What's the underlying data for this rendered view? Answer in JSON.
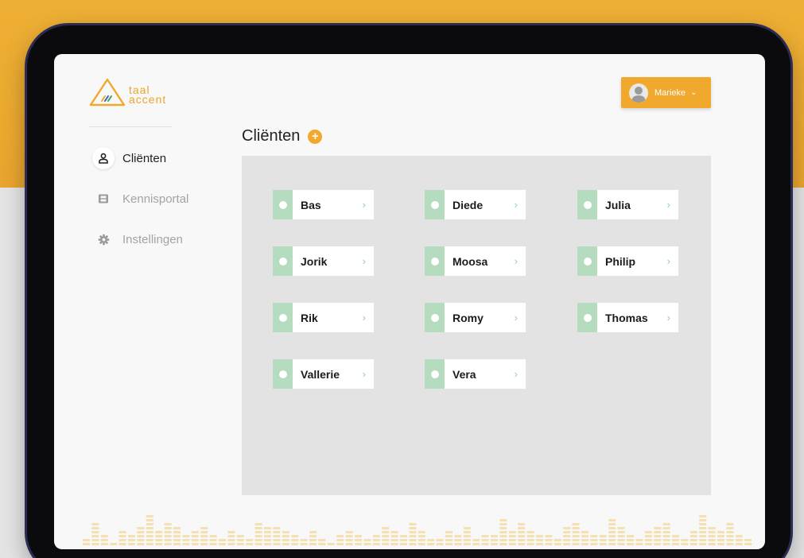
{
  "brand": {
    "line1": "taal",
    "line2": "accent",
    "accent_color": "#f0a92c"
  },
  "user": {
    "name": "Marieke"
  },
  "sidebar": {
    "items": [
      {
        "label": "Cliënten",
        "icon": "user-icon",
        "active": true
      },
      {
        "label": "Kennisportal",
        "icon": "film-icon",
        "active": false
      },
      {
        "label": "Instellingen",
        "icon": "gear-icon",
        "active": false
      }
    ]
  },
  "page": {
    "title": "Cliënten"
  },
  "clients": [
    "Bas",
    "Diede",
    "Julia",
    "Jorik",
    "Moosa",
    "Philip",
    "Rik",
    "Romy",
    "Thomas",
    "Vallerie",
    "Vera"
  ],
  "colors": {
    "card_strip": "#b6dcc0",
    "chevron": "#8fd0a8",
    "background_top": "#eeb034"
  }
}
